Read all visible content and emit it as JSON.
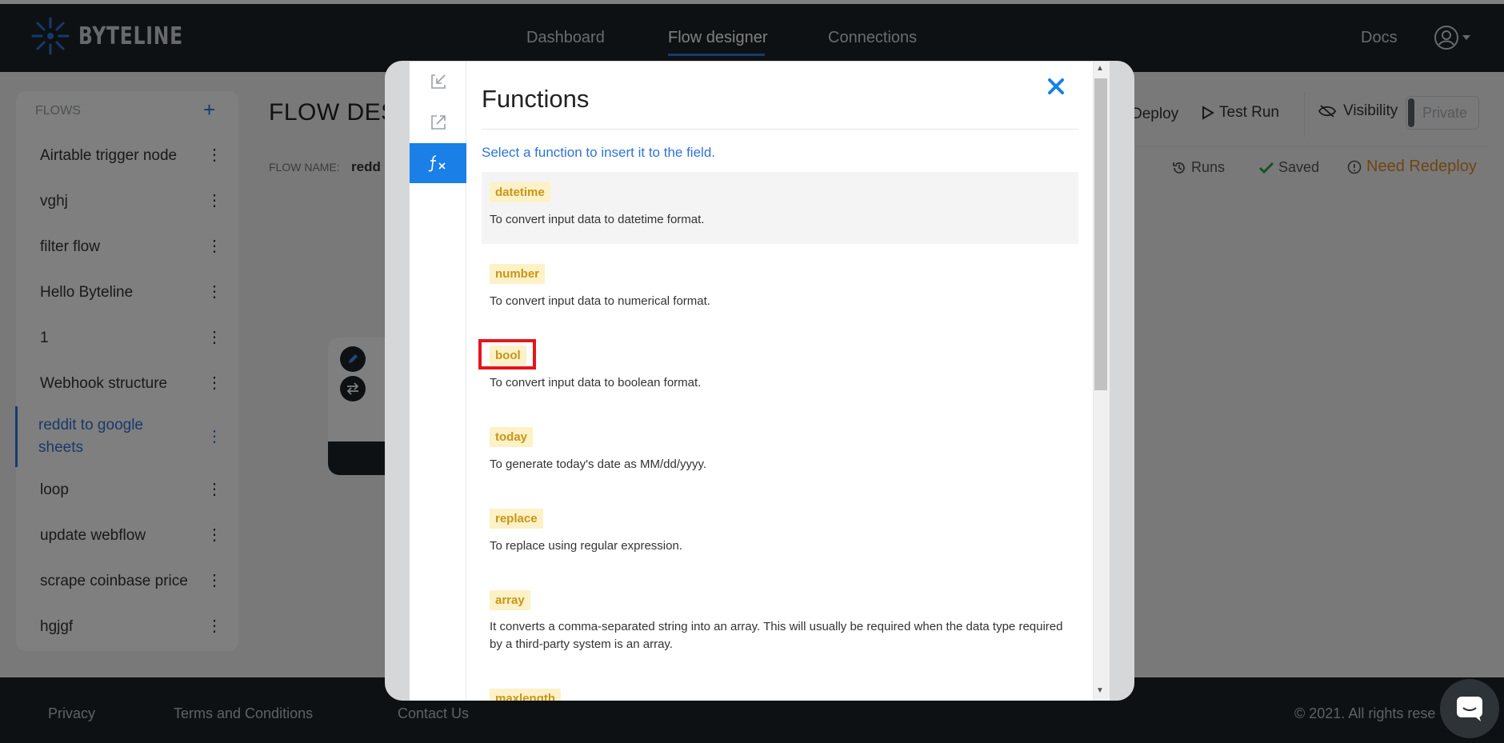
{
  "app": {
    "brand": "BYTELINE"
  },
  "nav": {
    "dashboard": "Dashboard",
    "flow_designer": "Flow designer",
    "connections": "Connections",
    "docs": "Docs"
  },
  "sidebar": {
    "header": "FLOWS",
    "add": "+",
    "items": [
      {
        "label": "Airtable trigger node"
      },
      {
        "label": "vghj"
      },
      {
        "label": "filter flow"
      },
      {
        "label": "Hello Byteline"
      },
      {
        "label": "1"
      },
      {
        "label": "Webhook structure"
      },
      {
        "label": "reddit to google sheets",
        "line1": "reddit to google",
        "line2": "sheets",
        "active": true
      },
      {
        "label": "loop"
      },
      {
        "label": "update webflow"
      },
      {
        "label": "scrape coinbase price"
      },
      {
        "label": "hgjgf"
      }
    ]
  },
  "designer": {
    "title": "FLOW DES",
    "flow_name_label": "FLOW NAME:",
    "flow_name_value": "redd",
    "deploy": "Deploy",
    "test_run": "Test Run",
    "visibility": "Visibility",
    "private": "Private",
    "runs": "Runs",
    "saved": "Saved",
    "need_redeploy": "Need Redeploy"
  },
  "footer": {
    "privacy": "Privacy",
    "terms": "Terms and Conditions",
    "contact": "Contact Us",
    "copyright": "© 2021. All rights rese"
  },
  "modal": {
    "title": "Functions",
    "hint": "Select a function to insert it to the field.",
    "functions": [
      {
        "name": "datetime",
        "description": "To convert input data to datetime format."
      },
      {
        "name": "number",
        "description": "To convert input data to numerical format."
      },
      {
        "name": "bool",
        "description": "To convert input data to boolean format."
      },
      {
        "name": "today",
        "description": "To generate today's date as MM/dd/yyyy."
      },
      {
        "name": "replace",
        "description": "To replace using regular expression."
      },
      {
        "name": "array",
        "description": "It converts a comma-separated string into an array. This will usually be required when the data type required by a third-party system is an array."
      },
      {
        "name": "maxlength",
        "description": ""
      }
    ]
  },
  "colors": {
    "accent": "#2e74d6",
    "tag_bg": "#fdf1c7",
    "tag_text": "#c7961a",
    "highlight_box": "#e4161b",
    "warning": "#e08a1e"
  }
}
